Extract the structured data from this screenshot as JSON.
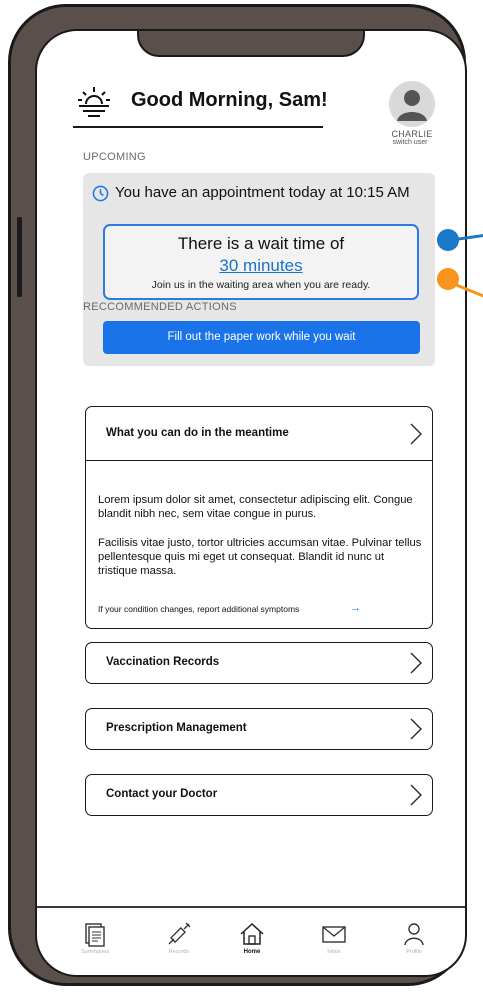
{
  "header": {
    "greeting": "Good Morning, Sam!",
    "user_name": "CHARLIE",
    "switch_user": "switch user"
  },
  "upcoming": {
    "section_label": "UPCOMING",
    "appointment_text": "You have an appointment today at 10:15 AM",
    "wait_line1": "There is a wait time of",
    "wait_time": "30 minutes",
    "wait_note": "Join us in the waiting area when you are ready.",
    "paperwork_button": "Fill out the paper work while you wait"
  },
  "recommended": {
    "section_label": "RECCOMMENDED ACTIONS",
    "expanded": {
      "title": "What you can do in the meantime",
      "paragraph1": "Lorem ipsum dolor sit amet, consectetur adipiscing elit. Congue blandit nibh nec, sem vitae congue in purus.",
      "paragraph2": "Facilisis vitae justo, tortor ultricies accumsan vitae. Pulvinar tellus pellentesque quis mi eget ut consequat. Blandit id nunc ut tristique massa.",
      "link_text": "If your condition changes, report additional symptoms"
    },
    "items": [
      {
        "label": "Vaccination Records"
      },
      {
        "label": "Prescription Management"
      },
      {
        "label": "Contact your Doctor"
      }
    ]
  },
  "bottom_nav": {
    "items": [
      {
        "label": "Summaries",
        "icon": "document-icon",
        "active": false
      },
      {
        "label": "Records",
        "icon": "syringe-icon",
        "active": false
      },
      {
        "label": "Home",
        "icon": "home-icon",
        "active": true
      },
      {
        "label": "Inbox",
        "icon": "envelope-icon",
        "active": false
      },
      {
        "label": "Profile",
        "icon": "person-icon",
        "active": false
      }
    ]
  },
  "colors": {
    "accent": "#1a73e8",
    "frame": "#5b4f4c",
    "card_background": "#e6e6e6",
    "annotation_blue": "#1a78c6",
    "annotation_orange": "#f7931e"
  }
}
